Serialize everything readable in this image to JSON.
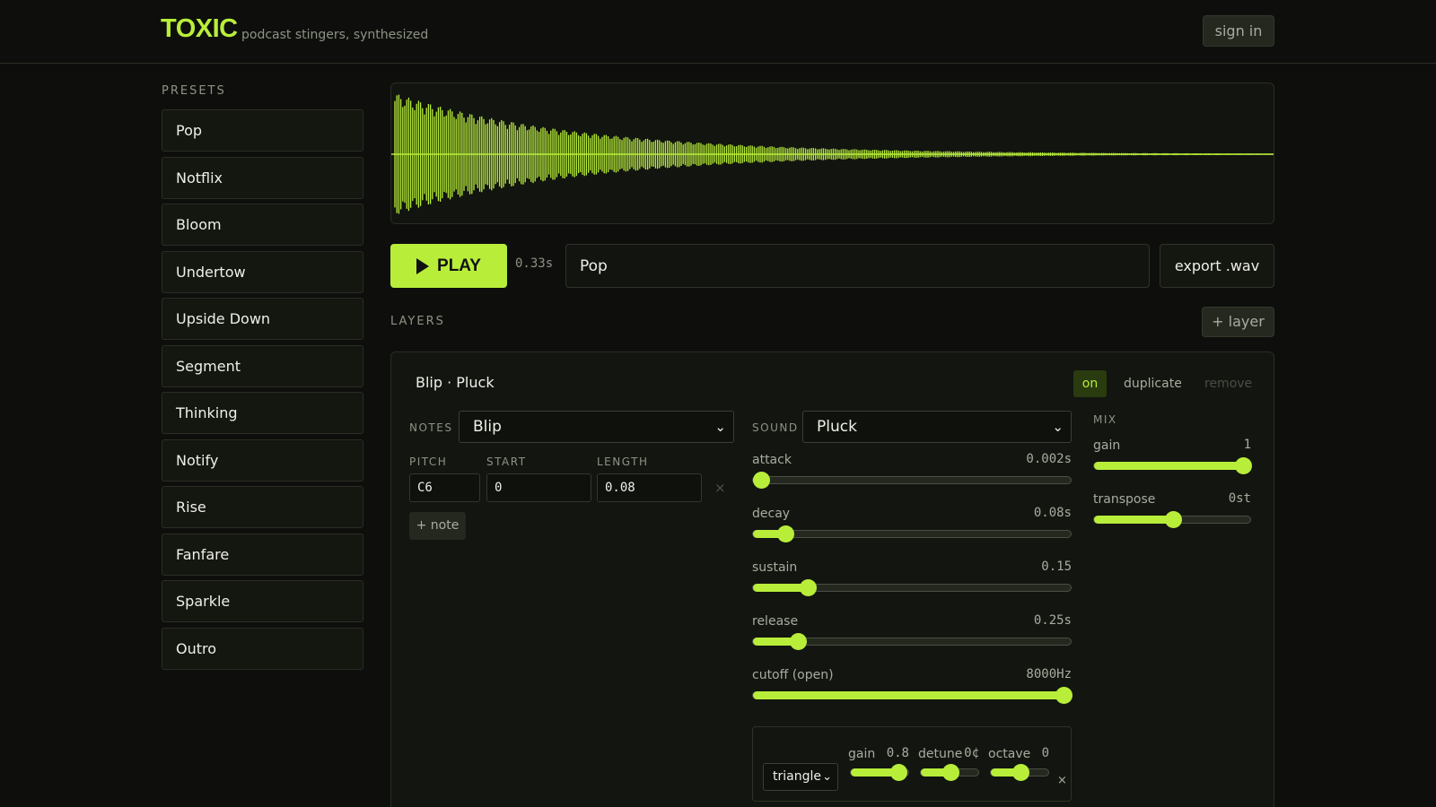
{
  "header": {
    "brand": "TOXIC",
    "tagline": "podcast stingers, synthesized",
    "signin": "sign in"
  },
  "presets": {
    "title": "PRESETS",
    "items": [
      "Pop",
      "Notflix",
      "Bloom",
      "Undertow",
      "Upside Down",
      "Segment",
      "Thinking",
      "Notify",
      "Rise",
      "Fanfare",
      "Sparkle",
      "Outro"
    ]
  },
  "transport": {
    "play": "PLAY",
    "duration": "0.33s",
    "name": "Pop",
    "export": "export .wav"
  },
  "layers": {
    "title": "LAYERS",
    "add": "+ layer"
  },
  "layer": {
    "title": "Blip · Pluck",
    "on": "on",
    "duplicate": "duplicate",
    "remove": "remove",
    "notes_label": "NOTES",
    "notes_select": "Blip",
    "sound_label": "SOUND",
    "sound_select": "Pluck",
    "pitch_label": "PITCH",
    "start_label": "START",
    "length_label": "LENGTH",
    "pitch": "C6",
    "start": "0",
    "length": "0.08",
    "add_note": "+ note",
    "remove_note": "×",
    "mix_label": "MIX",
    "envelope": [
      {
        "label": "attack",
        "value": "0.002s",
        "level": 0.02
      },
      {
        "label": "decay",
        "value": "0.08s",
        "level": 0.1
      },
      {
        "label": "sustain",
        "value": "0.15",
        "level": 0.17
      },
      {
        "label": "release",
        "value": "0.25s",
        "level": 0.14
      },
      {
        "label": "cutoff (open)",
        "value": "8000Hz",
        "level": 1.0
      }
    ],
    "mix": [
      {
        "label": "gain",
        "value": "1",
        "level": 1.0
      },
      {
        "label": "transpose",
        "value": "0st",
        "level": 0.5
      }
    ],
    "osc": {
      "wave": "triangle",
      "gain_label": "gain",
      "gain_value": "0.8",
      "gain_level": 0.8,
      "detune_label": "detune",
      "detune_value": "0¢",
      "detune_level": 0.5,
      "octave_label": "octave",
      "octave_value": "0",
      "octave_level": 0.5,
      "remove": "×"
    }
  },
  "colors": {
    "accent": "#b8ee3a",
    "background": "#0e0f0c",
    "panel": "#131510"
  },
  "icons": {
    "play": "play-triangle-icon",
    "dropdown": "chevron-down-icon",
    "close": "close-icon"
  }
}
